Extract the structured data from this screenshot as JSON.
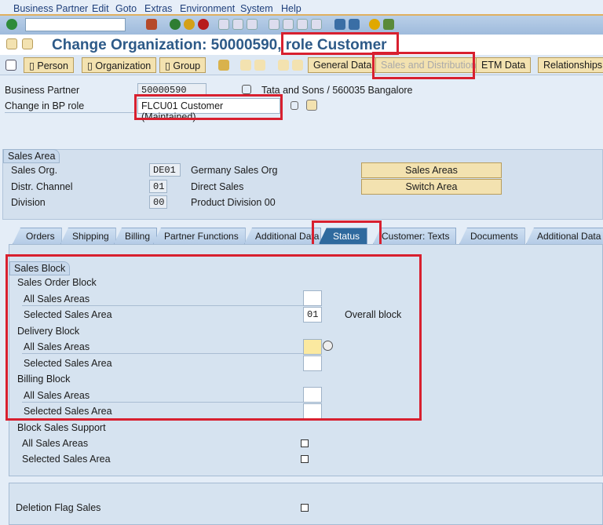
{
  "menu": [
    "Business Partner",
    "Edit",
    "Goto",
    "Extras",
    "Environment",
    "System",
    "Help"
  ],
  "command_field": {
    "value": ""
  },
  "title": "Change Organization: 50000590, role Customer",
  "app_toolbar": {
    "person": "Person",
    "organization": "Organization",
    "group": "Group",
    "general_data": "General Data",
    "sales_distribution": "Sales and Distribution",
    "etm_data": "ETM Data",
    "relationships": "Relationships"
  },
  "header": {
    "bp_label": "Business Partner",
    "bp_value": "50000590",
    "bp_desc": "Tata and Sons / 560035 Bangalore",
    "role_label": "Change in BP role",
    "role_value": "FLCU01 Customer (Maintained)"
  },
  "sales_area": {
    "title": "Sales Area",
    "rows": [
      {
        "label": "Sales Org.",
        "code": "DE01",
        "desc": "Germany Sales Org"
      },
      {
        "label": "Distr. Channel",
        "code": "01",
        "desc": "Direct Sales"
      },
      {
        "label": "Division",
        "code": "00",
        "desc": "Product Division 00"
      }
    ],
    "sales_areas_btn": "Sales Areas",
    "switch_area_btn": "Switch Area"
  },
  "tabs": [
    "Orders",
    "Shipping",
    "Billing",
    "Partner Functions",
    "Additional Data",
    "Status",
    "Customer: Texts",
    "Documents",
    "Additional Data"
  ],
  "active_tab": "Status",
  "sales_block": {
    "title": "Sales Block",
    "order_block": "Sales Order Block",
    "order_all": "All Sales Areas",
    "order_all_value": "",
    "order_sel": "Selected Sales Area",
    "order_sel_value": "01",
    "order_sel_desc": "Overall block",
    "delivery_block": "Delivery Block",
    "delivery_all": "All Sales Areas",
    "delivery_all_value": "",
    "delivery_sel": "Selected Sales Area",
    "delivery_sel_value": "",
    "billing_block": "Billing Block",
    "billing_all": "All Sales Areas",
    "billing_all_value": "",
    "billing_sel": "Selected Sales Area",
    "billing_sel_value": "",
    "support": "Block Sales Support",
    "support_all": "All Sales Areas",
    "support_all_checked": false,
    "support_sel": "Selected Sales Area",
    "support_sel_checked": false
  },
  "deletion": {
    "label": "Deletion Flag Sales",
    "checked": false
  },
  "colors": {
    "highlight": "#d8202f",
    "title": "#2d5a88",
    "button": "#f3e2b0",
    "active_tab": "#2f6a9e"
  }
}
